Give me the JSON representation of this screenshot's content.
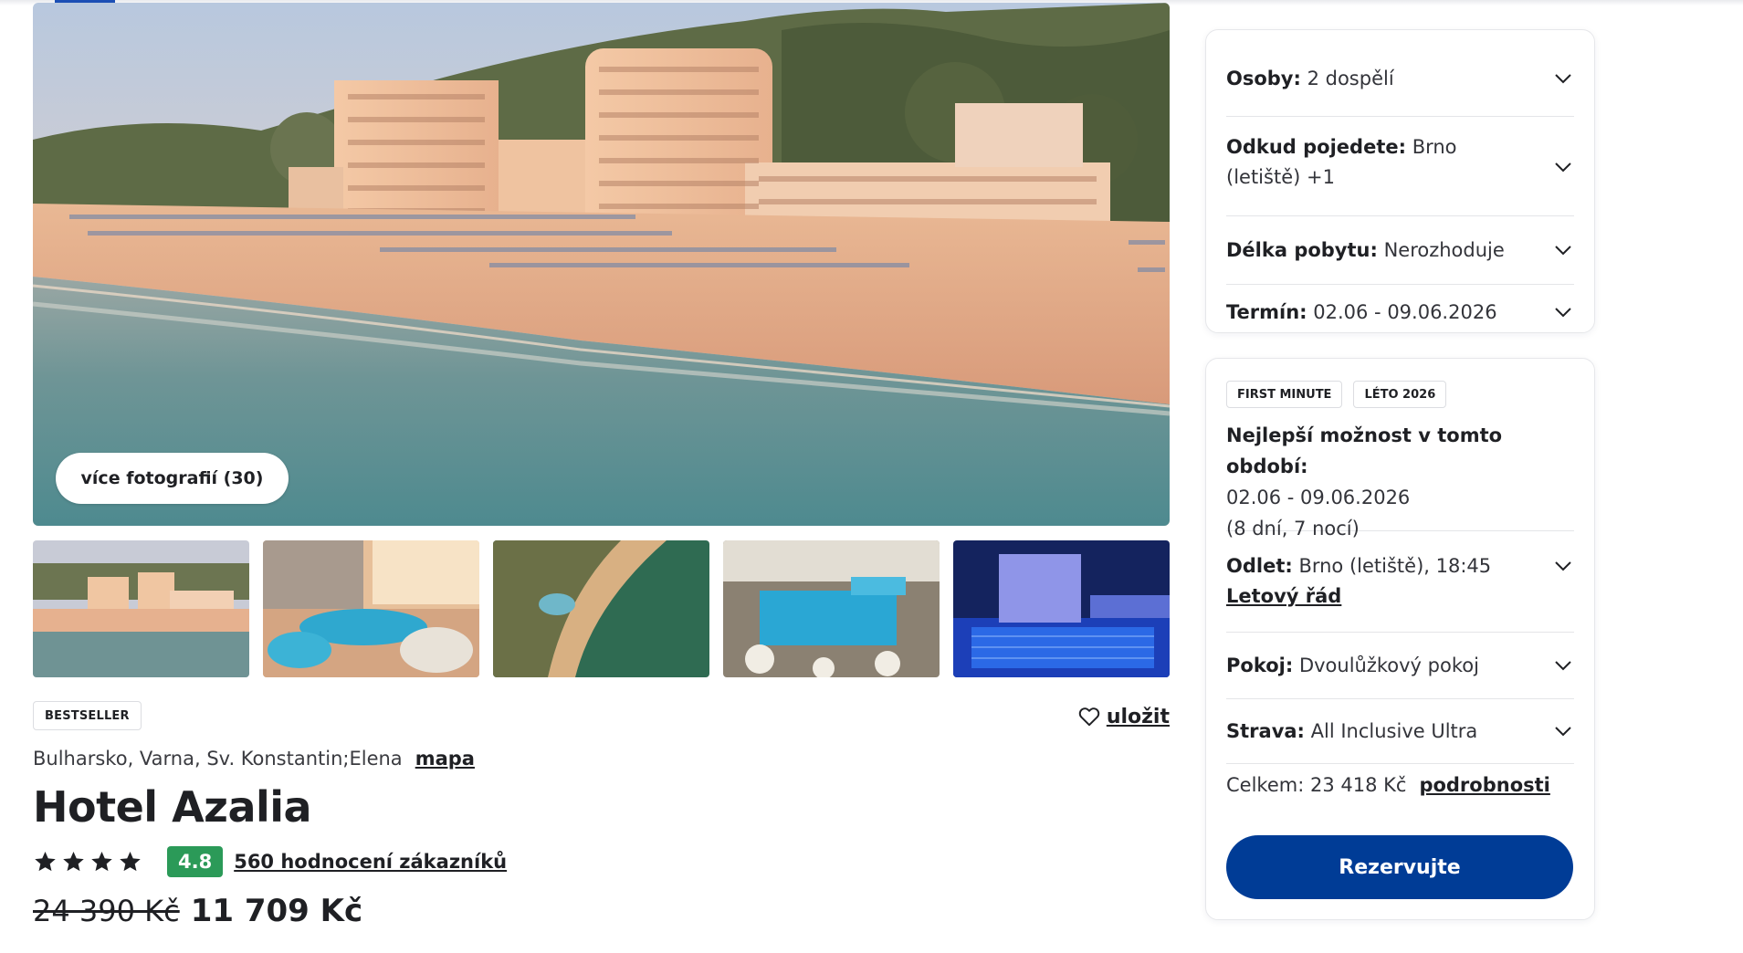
{
  "gallery": {
    "more_photos_label": "více fotografií (30)"
  },
  "hotel": {
    "badge": "BESTSELLER",
    "save_label": "uložit",
    "location": "Bulharsko, Varna, Sv. Konstantin;Elena",
    "map_label": "mapa",
    "name": "Hotel Azalia",
    "stars": 4,
    "score": "4.8",
    "reviews_label": "560 hodnocení zákazníků",
    "old_price": "24 390 Kč",
    "new_price": "11 709 Kč"
  },
  "filters": {
    "persons": {
      "label": "Osoby:",
      "value": "2 dospělí"
    },
    "departure": {
      "label": "Odkud pojedete:",
      "value": "Brno",
      "value2": "(letiště) +1"
    },
    "duration": {
      "label": "Délka pobytu:",
      "value": "Nerozhoduje"
    },
    "term": {
      "label": "Termín:",
      "value": "02.06 - 09.06.2026"
    }
  },
  "offer": {
    "tags": [
      "FIRST MINUTE",
      "LÉTO 2026"
    ],
    "best_title": "Nejlepší možnost v tomto období:",
    "best_dates": "02.06 - 09.06.2026",
    "best_nights": "(8 dní, 7 nocí)",
    "flight": {
      "label": "Odlet:",
      "value": "Brno (letiště), 18:45",
      "link": "Letový řád"
    },
    "room": {
      "label": "Pokoj:",
      "value": "Dvoulůžkový pokoj"
    },
    "board": {
      "label": "Strava:",
      "value": "All Inclusive Ultra"
    },
    "total_label": "Celkem: 23 418 Kč",
    "details_label": "podrobnosti",
    "reserve_label": "Rezervujte"
  },
  "colors": {
    "primary_button": "#003c96",
    "score_badge": "#2b9a58",
    "text": "#1f2024"
  }
}
